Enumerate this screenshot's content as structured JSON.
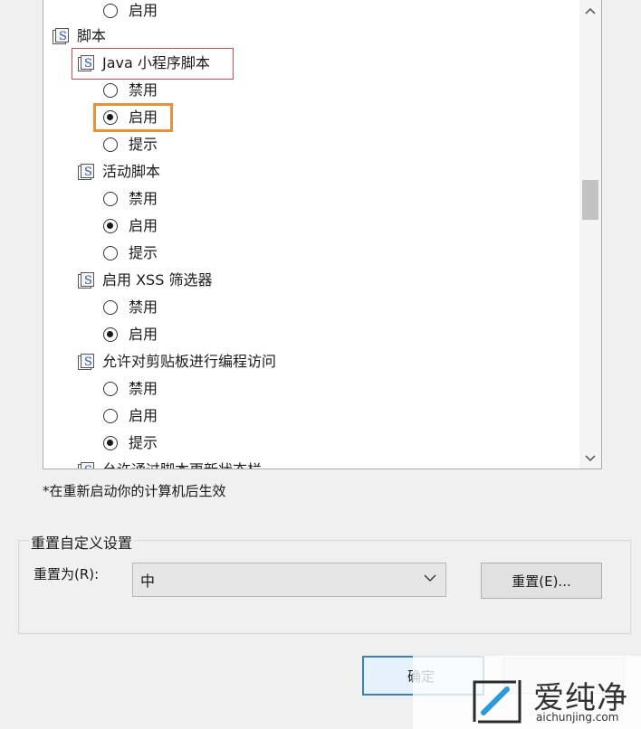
{
  "tree": {
    "top_option_label": "启用",
    "group_label": "脚本",
    "settings": [
      {
        "label": "Java 小程序脚本",
        "options": [
          "禁用",
          "启用",
          "提示"
        ],
        "selected": "启用"
      },
      {
        "label": "活动脚本",
        "options": [
          "禁用",
          "启用",
          "提示"
        ],
        "selected": "启用"
      },
      {
        "label": "启用 XSS 筛选器",
        "options": [
          "禁用",
          "启用"
        ],
        "selected": "启用"
      },
      {
        "label": "允许对剪贴板进行编程访问",
        "options": [
          "禁用",
          "启用",
          "提示"
        ],
        "selected": "提示"
      },
      {
        "label": "允许通过脚本更新状态栏"
      }
    ]
  },
  "restart_note": "*在重新启动你的计算机后生效",
  "reset": {
    "group_title": "重置自定义设置",
    "reset_to_label": "重置为(R):",
    "level_value": "中",
    "reset_button": "重置(E)..."
  },
  "buttons": {
    "ok": "确定",
    "cancel": ""
  },
  "watermark": {
    "brand": "爱纯净",
    "url": "aichunjing.com"
  },
  "icons": {
    "setting": "script-setting-icon",
    "scroll_up": "chevron-up-icon",
    "scroll_down": "chevron-down-icon",
    "dropdown": "chevron-down-icon"
  },
  "colors": {
    "highlight_red": "#d94a4a",
    "highlight_orange": "#e9923a",
    "ok_border": "#3c7fb1"
  }
}
